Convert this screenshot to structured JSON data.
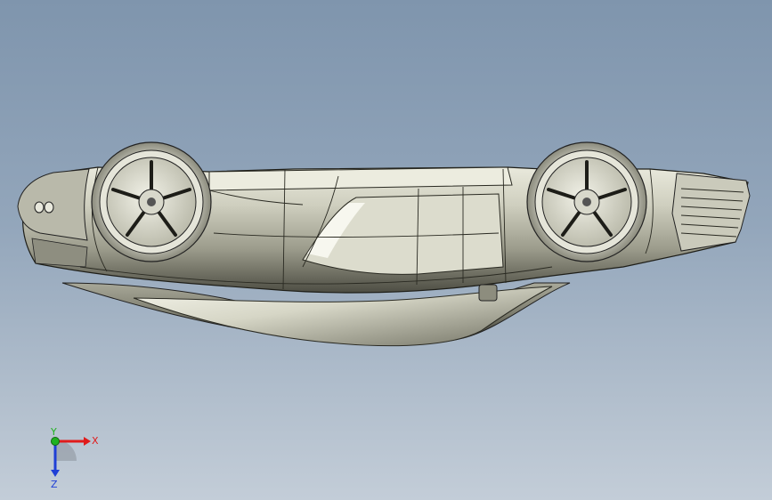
{
  "viewport": {
    "model": "car-body-upside-down",
    "background_top": "#7f95ad",
    "background_bottom": "#c3cdd8",
    "body_color": "#c9c9ba",
    "shade_color": "#5f5f52"
  },
  "triad": {
    "x_label": "X",
    "y_label": "Y",
    "z_label": "Z",
    "x_color": "#e01b1b",
    "y_color": "#1fb21f",
    "z_color": "#1f3fd6"
  }
}
